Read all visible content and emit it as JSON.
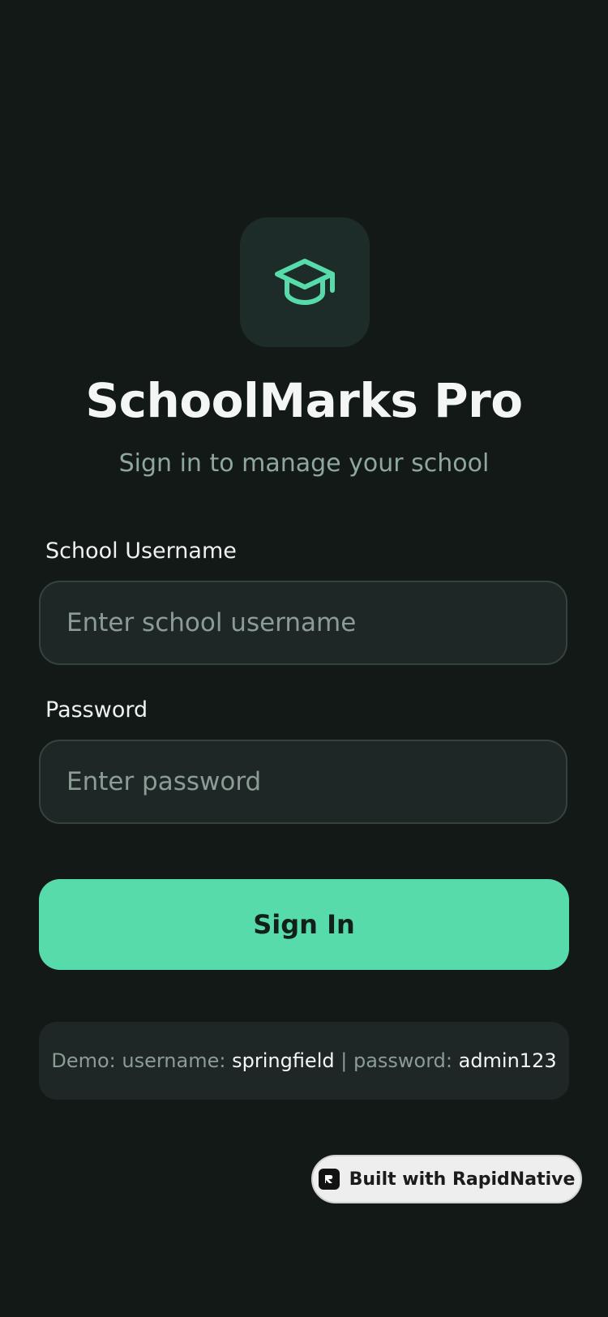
{
  "app": {
    "title": "SchoolMarks Pro",
    "subtitle": "Sign in to manage your school",
    "logo_icon": "graduation-cap-icon"
  },
  "form": {
    "username": {
      "label": "School Username",
      "placeholder": "Enter school username",
      "value": ""
    },
    "password": {
      "label": "Password",
      "placeholder": "Enter password",
      "value": ""
    },
    "submit_label": "Sign In"
  },
  "demo": {
    "prefix": "Demo: username: ",
    "username": "springfield",
    "separator": " | password: ",
    "password": "admin123"
  },
  "badge": {
    "icon": "rapidnative-logo-icon",
    "label": "Built with RapidNative"
  },
  "colors": {
    "background": "#121917",
    "accent": "#58dbab",
    "surface": "#1e2725",
    "muted_text": "#8b9c96"
  }
}
